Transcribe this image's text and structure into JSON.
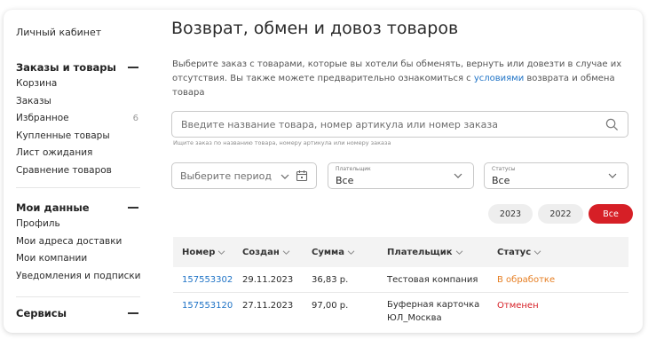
{
  "sidebar": {
    "cabinet": "Личный кабинет",
    "sections": [
      {
        "title": "Заказы и товары",
        "items": [
          {
            "label": "Корзина",
            "count": ""
          },
          {
            "label": "Заказы",
            "count": ""
          },
          {
            "label": "Избранное",
            "count": "6"
          },
          {
            "label": "Купленные товары",
            "count": ""
          },
          {
            "label": "Лист ожидания",
            "count": ""
          },
          {
            "label": "Сравнение товаров",
            "count": ""
          }
        ]
      },
      {
        "title": "Мои данные",
        "items": [
          {
            "label": "Профиль",
            "count": ""
          },
          {
            "label": "Мои адреса доставки",
            "count": ""
          },
          {
            "label": "Мои компании",
            "count": ""
          },
          {
            "label": "Уведомления и подписки",
            "count": ""
          }
        ]
      },
      {
        "title": "Сервисы",
        "items": []
      }
    ]
  },
  "main": {
    "title": "Возврат, обмен и довоз товаров",
    "description_before": "Выберите заказ с товарами, которые вы хотели бы обменять, вернуть или довезти в случае их отсутствия. Вы также можете предварительно ознакомиться с ",
    "description_link": "условиями",
    "description_after": " возврата и обмена товара",
    "search": {
      "placeholder": "Введите название товара, номер артикула или номер заказа",
      "hint": "Ищите заказ по названию товара, номеру артикула или номеру заказа"
    },
    "filters": {
      "period_placeholder": "Выберите период",
      "payer_label": "Плательщик",
      "payer_value": "Все",
      "status_label": "Статусы",
      "status_value": "Все"
    },
    "years": [
      {
        "label": "2023",
        "active": false
      },
      {
        "label": "2022",
        "active": false
      },
      {
        "label": "Все",
        "active": true
      }
    ],
    "table": {
      "columns": [
        "Номер",
        "Создан",
        "Сумма",
        "Плательщик",
        "Статус"
      ],
      "rows": [
        {
          "number": "157553302",
          "created": "29.11.2023",
          "sum": "36,83 р.",
          "payer": "Тестовая компания",
          "status": "В обработке"
        },
        {
          "number": "157553120",
          "created": "27.11.2023",
          "sum": "97,00 р.",
          "payer": "Буферная карточка ЮЛ_Москва",
          "status": "Отменен"
        }
      ]
    }
  },
  "colors": {
    "accent": "#d61f26",
    "link": "#1f73c6",
    "status_processing": "#e67e22",
    "status_cancelled": "#d61f26"
  }
}
